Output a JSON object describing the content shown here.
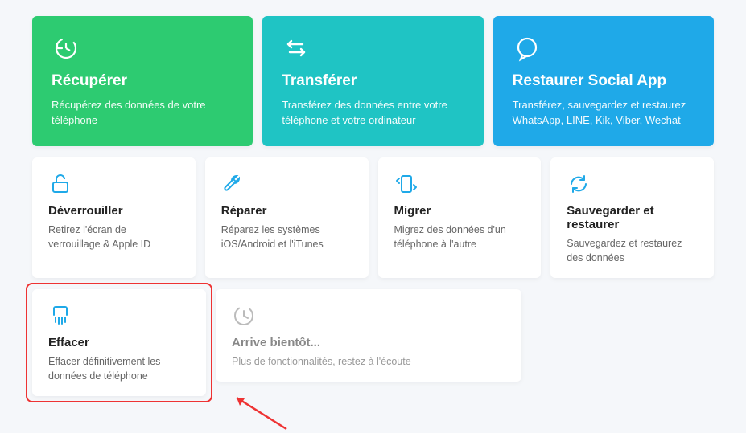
{
  "topCards": [
    {
      "title": "Récupérer",
      "desc": "Récupérez des données de votre téléphone"
    },
    {
      "title": "Transférer",
      "desc": "Transférez des données entre votre téléphone et votre ordinateur"
    },
    {
      "title": "Restaurer Social App",
      "desc": "Transférez, sauvegardez et restaurez WhatsApp, LINE, Kik, Viber, Wechat"
    }
  ],
  "midCards": [
    {
      "title": "Déverrouiller",
      "desc": "Retirez l'écran de verrouillage & Apple ID"
    },
    {
      "title": "Réparer",
      "desc": "Réparez les systèmes iOS/Android et l'iTunes"
    },
    {
      "title": "Migrer",
      "desc": "Migrez des données d'un téléphone à l'autre"
    },
    {
      "title": "Sauvegarder et restaurer",
      "desc": "Sauvegardez et restaurez des données"
    }
  ],
  "bottomCards": [
    {
      "title": "Effacer",
      "desc": "Effacer définitivement les données de téléphone"
    },
    {
      "title": "Arrive bientôt...",
      "desc": "Plus de fonctionnalités, restez à l'écoute"
    }
  ]
}
